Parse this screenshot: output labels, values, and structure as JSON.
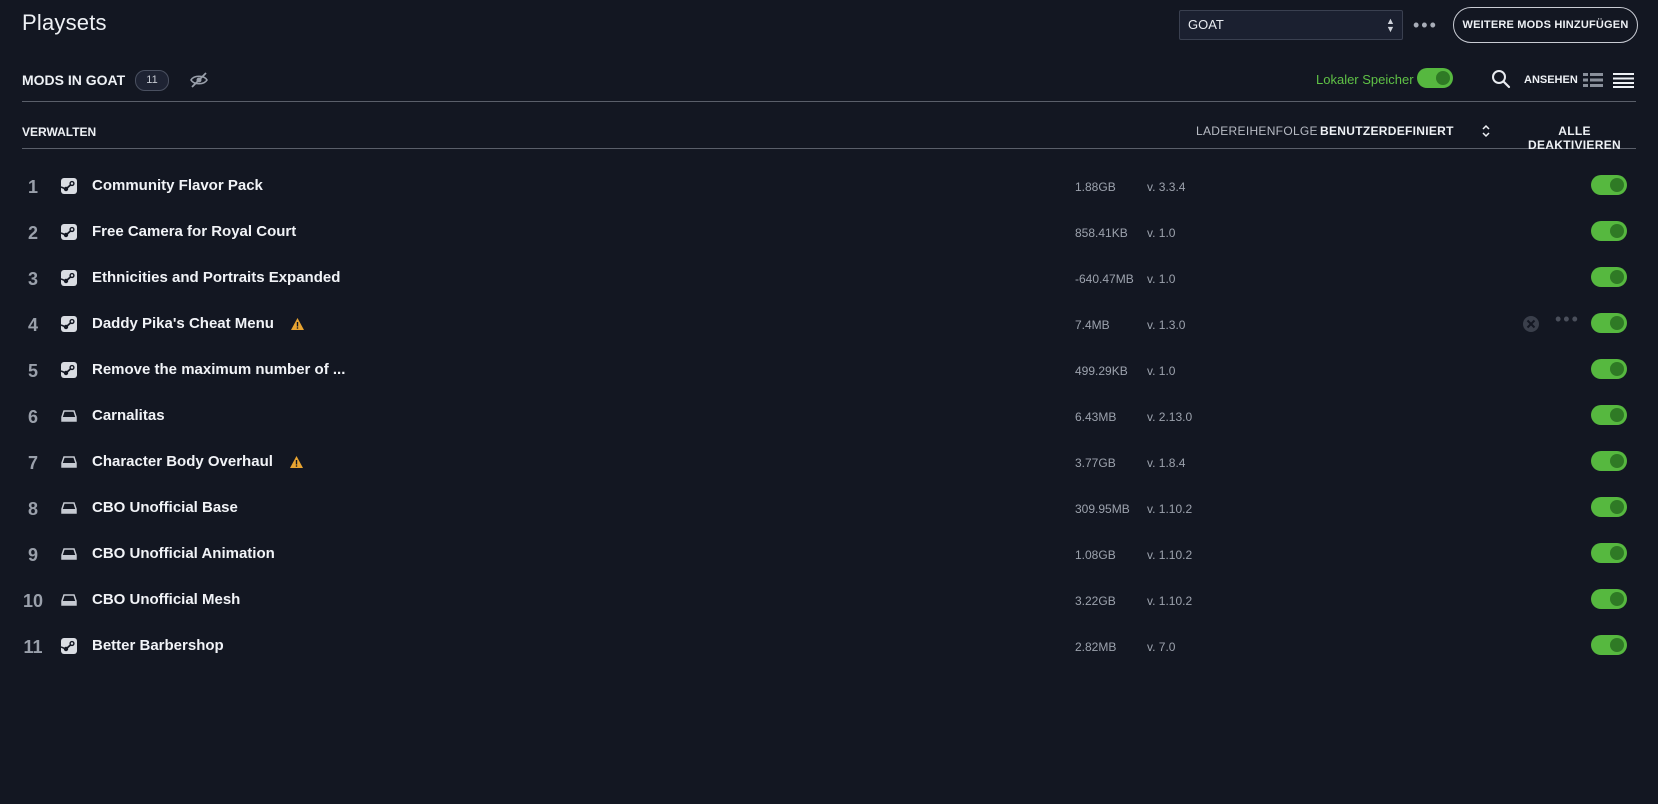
{
  "header": {
    "title": "Playsets",
    "playset_select": "GOAT",
    "more_label": "•••",
    "add_mods_label": "WEITERE MODS HINZUFÜGEN"
  },
  "mods_header": {
    "title": "MODS IN GOAT",
    "count": "11",
    "local_storage_label": "Lokaler Speicher",
    "local_storage_enabled": true,
    "view_label": "ANSEHEN"
  },
  "manage_row": {
    "manage_label": "VERWALTEN",
    "load_order_label": "LADEREIHENFOLGE",
    "load_order_value": "BENUTZERDEFINIERT",
    "disable_all_label": "ALLE DEAKTIVIEREN"
  },
  "colors": {
    "background": "#131722",
    "accent_green": "#56b83f",
    "warning": "#e8a431"
  },
  "mods": [
    {
      "index": "1",
      "source": "steam-icon",
      "name": "Community Flavor Pack",
      "size": "1.88GB",
      "version": "v. 3.3.4",
      "warning": false,
      "enabled": true
    },
    {
      "index": "2",
      "source": "steam-icon",
      "name": "Free Camera for Royal Court",
      "size": "858.41KB",
      "version": "v. 1.0",
      "warning": false,
      "enabled": true
    },
    {
      "index": "3",
      "source": "steam-icon",
      "name": "Ethnicities and Portraits Expanded",
      "size": "-640.47MB",
      "version": "v. 1.0",
      "warning": false,
      "enabled": true
    },
    {
      "index": "4",
      "source": "steam-icon",
      "name": "Daddy Pika's Cheat Menu",
      "size": "7.4MB",
      "version": "v. 1.3.0",
      "warning": true,
      "enabled": true
    },
    {
      "index": "5",
      "source": "steam-icon",
      "name": "Remove the maximum number of ...",
      "size": "499.29KB",
      "version": "v. 1.0",
      "warning": false,
      "enabled": true
    },
    {
      "index": "6",
      "source": "local-drive-icon",
      "name": "Carnalitas",
      "size": "6.43MB",
      "version": "v. 2.13.0",
      "warning": false,
      "enabled": true
    },
    {
      "index": "7",
      "source": "local-drive-icon",
      "name": "Character Body Overhaul",
      "size": "3.77GB",
      "version": "v. 1.8.4",
      "warning": true,
      "enabled": true
    },
    {
      "index": "8",
      "source": "local-drive-icon",
      "name": "CBO Unofficial Base",
      "size": "309.95MB",
      "version": "v. 1.10.2",
      "warning": false,
      "enabled": true
    },
    {
      "index": "9",
      "source": "local-drive-icon",
      "name": "CBO Unofficial Animation",
      "size": "1.08GB",
      "version": "v. 1.10.2",
      "warning": false,
      "enabled": true
    },
    {
      "index": "10",
      "source": "local-drive-icon",
      "name": "CBO Unofficial Mesh",
      "size": "3.22GB",
      "version": "v. 1.10.2",
      "warning": false,
      "enabled": true
    },
    {
      "index": "11",
      "source": "steam-icon",
      "name": "Better Barbershop",
      "size": "2.82MB",
      "version": "v. 7.0",
      "warning": false,
      "enabled": true
    }
  ]
}
